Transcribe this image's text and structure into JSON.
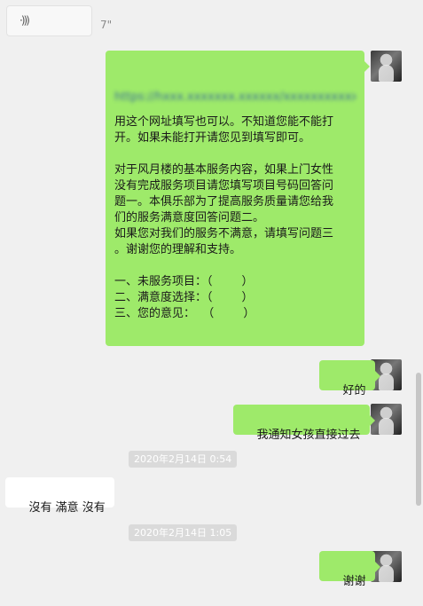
{
  "voice_message": {
    "icon": "voice-wave-icon",
    "duration": "7\""
  },
  "messages": {
    "long": {
      "url_text": "https://hxxx.xxxxxxx.xxxxxx/xxxxxxxxxxxxx",
      "body": "用这个网址填写也可以。不知道您能不能打\n开。如果未能打开请您见到填写即可。\n\n对于风月楼的基本服务内容，如果上门女性\n没有完成服务项目请您填写项目号码回答问\n题一。本俱乐部为了提高服务质量请您给我\n们的服务满意度回答问题二。\n如果您对我们的服务不满意，请填写问题三\n。谢谢您的理解和支持。\n\n一、未服务项目：（        ）\n二、满意度选择：（        ）\n三、您的意见：  （        ）"
    },
    "ok": "好的",
    "notify": "我通知女孩直接过去",
    "reply": "沒有 滿意 沒有",
    "thanks": "谢谢"
  },
  "timestamps": {
    "first": "2020年2月14日 0:54",
    "second": "2020年2月14日 1:05"
  },
  "colors": {
    "sent_bubble": "#9eea6a",
    "received_bubble": "#ffffff",
    "background": "#f0f0f0"
  }
}
